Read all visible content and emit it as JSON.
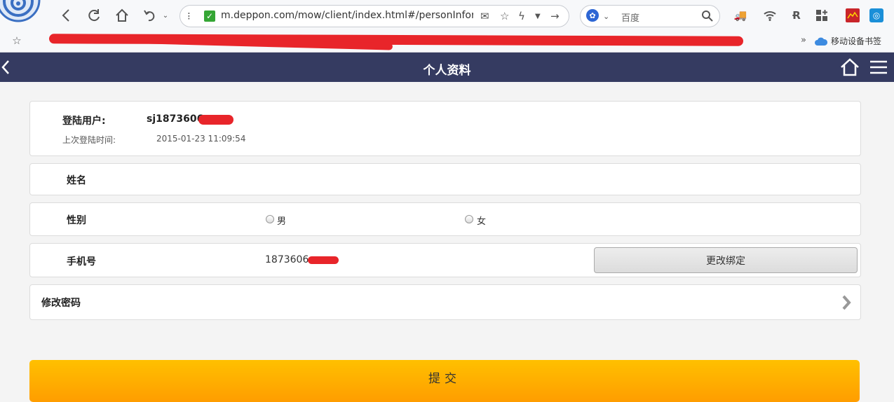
{
  "browser": {
    "url": "m.deppon.com/mow/client/index.html#/personInform",
    "search_engine_label": "百度",
    "mobile_bookmarks_label": "移动设备书签",
    "more_bookmarks": "»"
  },
  "header": {
    "title": "个人资料",
    "bg_color": "#353b61"
  },
  "account": {
    "user_label": "登陆用户:",
    "user_value": "sj1873606",
    "last_login_label": "上次登陆时间:",
    "last_login_value": "2015-01-23 11:09:54"
  },
  "name_field": {
    "label": "姓名"
  },
  "gender_field": {
    "label": "性别",
    "options": [
      "男",
      "女"
    ]
  },
  "phone_field": {
    "label": "手机号",
    "value": "1873606",
    "change_button": "更改绑定"
  },
  "password_row": {
    "label": "修改密码"
  },
  "submit": {
    "label": "提交",
    "color_top": "#ffc000",
    "color_bottom": "#ff9d00"
  },
  "redaction_color": "#e8252a"
}
